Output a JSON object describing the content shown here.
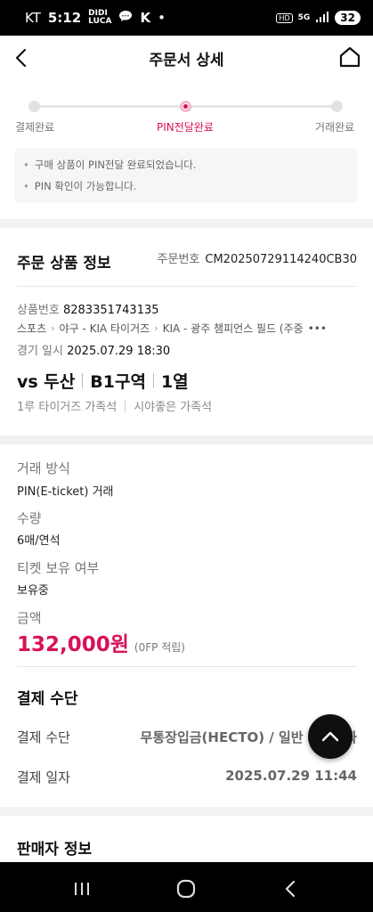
{
  "status_bar": {
    "carrier": "KT",
    "time": "5:12",
    "app_badge_top": "DIDI",
    "app_badge_bottom": "LUCA",
    "network": "5G",
    "hd": "HD",
    "battery": "32"
  },
  "header": {
    "title": "주문서 상세"
  },
  "progress": {
    "steps": [
      {
        "label": "결제완료"
      },
      {
        "label": "PIN전달완료"
      },
      {
        "label": "거래완료"
      }
    ],
    "active_color": "#d8115a"
  },
  "notice": {
    "lines": [
      "구매 상품이 PIN전달 완료되었습니다.",
      "PIN 확인이 가능합니다."
    ]
  },
  "order_info": {
    "title": "주문 상품 정보",
    "order_no_label": "주문번호",
    "order_no": "CM20250729114240CB30",
    "product_no_label": "상품번호",
    "product_no": "8283351743135",
    "breadcrumb": [
      "스포츠",
      "야구 - KIA 타이거즈",
      "KIA - 광주 챔피언스 필드 (주중"
    ],
    "breadcrumb_more": "•••",
    "game_date_label": "경기 일시",
    "game_date": "2025.07.29 18:30",
    "match": [
      "vs 두산",
      "B1구역",
      "1열"
    ],
    "tags": [
      "1루 타이거즈 가족석",
      "시야좋은 가족석"
    ]
  },
  "trade": {
    "method_label": "거래 방식",
    "method": "PIN(E-ticket) 거래",
    "qty_label": "수량",
    "qty": "6매/연석",
    "holding_label": "티켓 보유 여부",
    "holding": "보유중",
    "amount_label": "금액",
    "amount": "132,000원",
    "points": "(0FP 적립)"
  },
  "payment": {
    "title": "결제 수단",
    "method_label": "결제 수단",
    "method": "무통장입금(HECTO) / 일반 가상계좌",
    "date_label": "결제 일자",
    "date": "2025.07.29 11:44"
  },
  "seller": {
    "title": "판매자 정보"
  }
}
